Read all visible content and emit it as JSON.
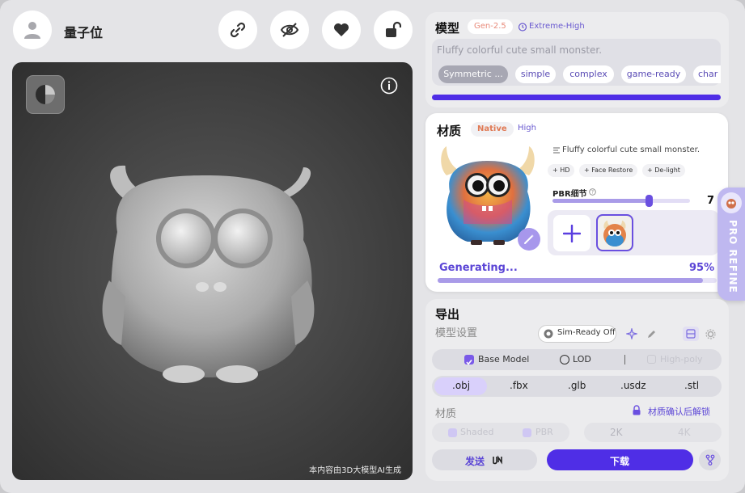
{
  "header": {
    "username": "量子位"
  },
  "viewport": {
    "watermark": "本内容由3D大模型AI生成"
  },
  "model": {
    "title": "模型",
    "version": "Gen-2.5",
    "quality": "Extreme-High",
    "prompt": "Fluffy colorful cute small monster.",
    "tags": [
      "Symmetric ...",
      "simple",
      "complex",
      "game-ready",
      "char"
    ]
  },
  "material": {
    "title": "材质",
    "mode": "Native",
    "quality": "High",
    "prompt": "Fluffy colorful cute small monster.",
    "options": [
      "+ HD",
      "+ Face Restore",
      "+ De-light"
    ],
    "pbr_label": "PBR细节",
    "pbr_value": "7",
    "pbr_level": 0.7,
    "status": "Generating...",
    "progress_text": "95%",
    "progress": 0.95,
    "pro_refine": "PRO REFINE"
  },
  "export": {
    "title": "导出",
    "settings_label": "模型设置",
    "sim_ready": "Sim-Ready Off",
    "base_model": "Base Model",
    "lod": "LOD",
    "high_poly": "High-poly",
    "formats": [
      ".obj",
      ".fbx",
      ".glb",
      ".usdz",
      ".stl"
    ],
    "material_label": "材质",
    "material_lock": "材质确认后解锁",
    "shaded": "Shaded",
    "pbr": "PBR",
    "res_2k": "2K",
    "res_4k": "4K",
    "send": "发送",
    "download": "下载"
  },
  "colors": {
    "accent": "#4f2ee6",
    "accent_light": "#a99be8",
    "viewport_bg": "#3d3d3d"
  }
}
